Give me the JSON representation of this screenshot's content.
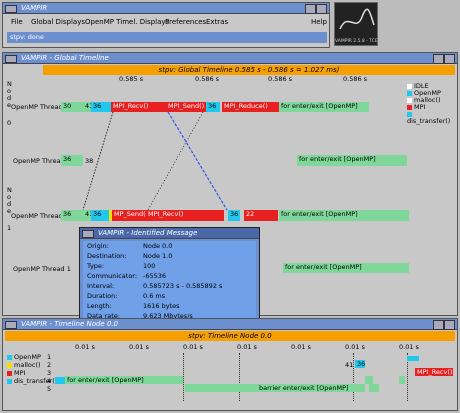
{
  "main_window": {
    "title": "VAMPIR",
    "menu": [
      "File",
      "Global Displays",
      "OpenMP Timel. Displays",
      "Preferences",
      "Extras"
    ],
    "help": "Help",
    "status": "stpv: done"
  },
  "mini_window": {
    "caption": "VAMPIR 2.5.8 - TCE"
  },
  "global_window": {
    "title": "VAMPIR - Global Timeline",
    "status": "stpv: Global Timeline 0.585 s - 0.586 s = 1.027 ms)",
    "ticks": [
      "0.585 s",
      "0.586 s",
      "0.586 s",
      "0.586 s"
    ],
    "legend": [
      {
        "name": "IDLE",
        "color": "#ffffff"
      },
      {
        "name": "OpenMP",
        "color": "#20c8ee"
      },
      {
        "name": "malloc()",
        "color": "#ffffff"
      },
      {
        "name": "MPI",
        "color": "#e82020"
      },
      {
        "name": "dis_transfer()",
        "color": "#20c8ee"
      }
    ],
    "node0": {
      "left_letters": [
        "N",
        "o",
        "d",
        "e",
        "0"
      ],
      "thread0": "OpenMP Thread 0",
      "thread1": "OpenMP Thread 1",
      "marker_d": "0"
    },
    "node1": {
      "left_letters": [
        "N",
        "o",
        "d",
        "e",
        "1"
      ],
      "thread0": "OpenMP Thread 0",
      "thread1": "OpenMP Thread 1",
      "marker_d": "1"
    },
    "bars": {
      "n0t0": [
        "30",
        "41",
        "36",
        "MPI_Recv()",
        "MPI_Send()",
        "36",
        "MPI_Reduce()",
        "for enter/exit [OpenMP]"
      ],
      "n0t1": [
        "36",
        "38",
        "for enter/exit [OpenMP]"
      ],
      "n1t0": [
        "36",
        "41",
        "36",
        "MP_Send()",
        "MPI_Recv()",
        "36",
        "22",
        "for enter/exit [OpenMP]"
      ],
      "n1t1": [
        "for enter/exit [OpenMP]"
      ]
    }
  },
  "message_window": {
    "title": "VAMPIR - Identified Message",
    "rows": [
      {
        "k": "Origin:",
        "v": "Node 0.0"
      },
      {
        "k": "Destination:",
        "v": "Node 1.0"
      },
      {
        "k": "Type:",
        "v": "100"
      },
      {
        "k": "Communicator:",
        "v": "-65536"
      },
      {
        "k": "Interval:",
        "v": "0.585723 s - 0.585892 s"
      },
      {
        "k": "Duration:",
        "v": "0.6 ms"
      },
      {
        "k": "Length:",
        "v": "1616 bytes"
      },
      {
        "k": "Data rate:",
        "v": "9.623 Mbytes/s"
      }
    ]
  },
  "node_window": {
    "title": "VAMPIR - Timeline Node 0.0",
    "status": "stpv: Timeline Node 0.0",
    "ticks": [
      "0.01 s",
      "0.01 s",
      "0.01 s",
      "0.01 s",
      "0.01 s",
      "0.01 s",
      "0.01 s"
    ],
    "legend": [
      {
        "name": "OpenMP",
        "color": "#20c8ee"
      },
      {
        "name": "malloc()",
        "color": "#f0e000"
      },
      {
        "name": "MPI",
        "color": "#e82020"
      },
      {
        "name": "dis_transfer()",
        "color": "#20c8ee"
      }
    ],
    "rows": [
      "1",
      "2",
      "3",
      "4",
      "5"
    ],
    "bars": {
      "r4a": "for enter/exit [OpenMP]",
      "r5": "barrier enter/exit [OpenMP]",
      "mpi": "MPI_Recv()",
      "n41": "41",
      "n36": "36"
    }
  }
}
